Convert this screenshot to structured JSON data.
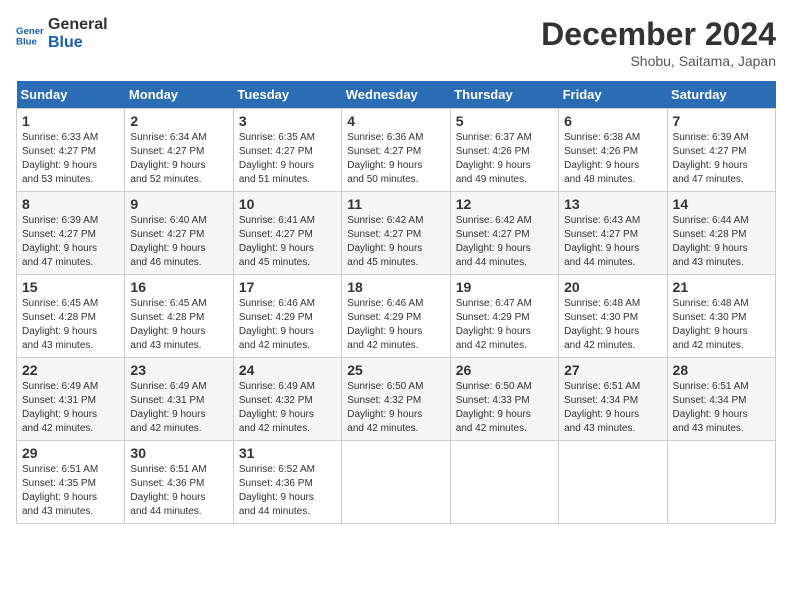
{
  "header": {
    "logo_line1": "General",
    "logo_line2": "Blue",
    "month": "December 2024",
    "location": "Shobu, Saitama, Japan"
  },
  "weekdays": [
    "Sunday",
    "Monday",
    "Tuesday",
    "Wednesday",
    "Thursday",
    "Friday",
    "Saturday"
  ],
  "weeks": [
    [
      {
        "day": "1",
        "info": "Sunrise: 6:33 AM\nSunset: 4:27 PM\nDaylight: 9 hours\nand 53 minutes."
      },
      {
        "day": "2",
        "info": "Sunrise: 6:34 AM\nSunset: 4:27 PM\nDaylight: 9 hours\nand 52 minutes."
      },
      {
        "day": "3",
        "info": "Sunrise: 6:35 AM\nSunset: 4:27 PM\nDaylight: 9 hours\nand 51 minutes."
      },
      {
        "day": "4",
        "info": "Sunrise: 6:36 AM\nSunset: 4:27 PM\nDaylight: 9 hours\nand 50 minutes."
      },
      {
        "day": "5",
        "info": "Sunrise: 6:37 AM\nSunset: 4:26 PM\nDaylight: 9 hours\nand 49 minutes."
      },
      {
        "day": "6",
        "info": "Sunrise: 6:38 AM\nSunset: 4:26 PM\nDaylight: 9 hours\nand 48 minutes."
      },
      {
        "day": "7",
        "info": "Sunrise: 6:39 AM\nSunset: 4:27 PM\nDaylight: 9 hours\nand 47 minutes."
      }
    ],
    [
      {
        "day": "8",
        "info": "Sunrise: 6:39 AM\nSunset: 4:27 PM\nDaylight: 9 hours\nand 47 minutes."
      },
      {
        "day": "9",
        "info": "Sunrise: 6:40 AM\nSunset: 4:27 PM\nDaylight: 9 hours\nand 46 minutes."
      },
      {
        "day": "10",
        "info": "Sunrise: 6:41 AM\nSunset: 4:27 PM\nDaylight: 9 hours\nand 45 minutes."
      },
      {
        "day": "11",
        "info": "Sunrise: 6:42 AM\nSunset: 4:27 PM\nDaylight: 9 hours\nand 45 minutes."
      },
      {
        "day": "12",
        "info": "Sunrise: 6:42 AM\nSunset: 4:27 PM\nDaylight: 9 hours\nand 44 minutes."
      },
      {
        "day": "13",
        "info": "Sunrise: 6:43 AM\nSunset: 4:27 PM\nDaylight: 9 hours\nand 44 minutes."
      },
      {
        "day": "14",
        "info": "Sunrise: 6:44 AM\nSunset: 4:28 PM\nDaylight: 9 hours\nand 43 minutes."
      }
    ],
    [
      {
        "day": "15",
        "info": "Sunrise: 6:45 AM\nSunset: 4:28 PM\nDaylight: 9 hours\nand 43 minutes."
      },
      {
        "day": "16",
        "info": "Sunrise: 6:45 AM\nSunset: 4:28 PM\nDaylight: 9 hours\nand 43 minutes."
      },
      {
        "day": "17",
        "info": "Sunrise: 6:46 AM\nSunset: 4:29 PM\nDaylight: 9 hours\nand 42 minutes."
      },
      {
        "day": "18",
        "info": "Sunrise: 6:46 AM\nSunset: 4:29 PM\nDaylight: 9 hours\nand 42 minutes."
      },
      {
        "day": "19",
        "info": "Sunrise: 6:47 AM\nSunset: 4:29 PM\nDaylight: 9 hours\nand 42 minutes."
      },
      {
        "day": "20",
        "info": "Sunrise: 6:48 AM\nSunset: 4:30 PM\nDaylight: 9 hours\nand 42 minutes."
      },
      {
        "day": "21",
        "info": "Sunrise: 6:48 AM\nSunset: 4:30 PM\nDaylight: 9 hours\nand 42 minutes."
      }
    ],
    [
      {
        "day": "22",
        "info": "Sunrise: 6:49 AM\nSunset: 4:31 PM\nDaylight: 9 hours\nand 42 minutes."
      },
      {
        "day": "23",
        "info": "Sunrise: 6:49 AM\nSunset: 4:31 PM\nDaylight: 9 hours\nand 42 minutes."
      },
      {
        "day": "24",
        "info": "Sunrise: 6:49 AM\nSunset: 4:32 PM\nDaylight: 9 hours\nand 42 minutes."
      },
      {
        "day": "25",
        "info": "Sunrise: 6:50 AM\nSunset: 4:32 PM\nDaylight: 9 hours\nand 42 minutes."
      },
      {
        "day": "26",
        "info": "Sunrise: 6:50 AM\nSunset: 4:33 PM\nDaylight: 9 hours\nand 42 minutes."
      },
      {
        "day": "27",
        "info": "Sunrise: 6:51 AM\nSunset: 4:34 PM\nDaylight: 9 hours\nand 43 minutes."
      },
      {
        "day": "28",
        "info": "Sunrise: 6:51 AM\nSunset: 4:34 PM\nDaylight: 9 hours\nand 43 minutes."
      }
    ],
    [
      {
        "day": "29",
        "info": "Sunrise: 6:51 AM\nSunset: 4:35 PM\nDaylight: 9 hours\nand 43 minutes."
      },
      {
        "day": "30",
        "info": "Sunrise: 6:51 AM\nSunset: 4:36 PM\nDaylight: 9 hours\nand 44 minutes."
      },
      {
        "day": "31",
        "info": "Sunrise: 6:52 AM\nSunset: 4:36 PM\nDaylight: 9 hours\nand 44 minutes."
      },
      null,
      null,
      null,
      null
    ]
  ]
}
